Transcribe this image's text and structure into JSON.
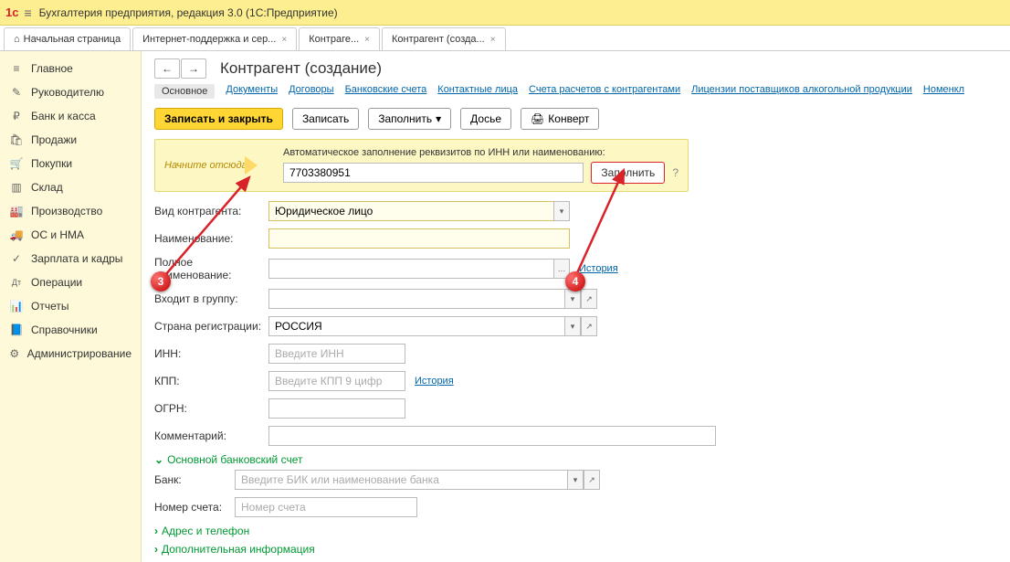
{
  "titlebar": {
    "title": "Бухгалтерия предприятия, редакция 3.0   (1С:Предприятие)"
  },
  "tabs": [
    {
      "label": "Начальная страница",
      "closable": false,
      "home": true
    },
    {
      "label": "Интернет-поддержка и сер...",
      "closable": true
    },
    {
      "label": "Контраге...",
      "closable": true
    },
    {
      "label": "Контрагент (созда...",
      "closable": true,
      "active": true
    }
  ],
  "sidebar": [
    {
      "icon": "≡",
      "label": "Главное"
    },
    {
      "icon": "✎",
      "label": "Руководителю"
    },
    {
      "icon": "₽",
      "label": "Банк и касса"
    },
    {
      "icon": "🛍",
      "label": "Продажи"
    },
    {
      "icon": "🛒",
      "label": "Покупки"
    },
    {
      "icon": "▥",
      "label": "Склад"
    },
    {
      "icon": "🏭",
      "label": "Производство"
    },
    {
      "icon": "🚚",
      "label": "ОС и НМА"
    },
    {
      "icon": "✓",
      "label": "Зарплата и кадры"
    },
    {
      "icon": "Дт",
      "label": "Операции"
    },
    {
      "icon": "📊",
      "label": "Отчеты"
    },
    {
      "icon": "📘",
      "label": "Справочники"
    },
    {
      "icon": "⚙",
      "label": "Администрирование"
    }
  ],
  "page": {
    "heading": "Контрагент (создание)",
    "links": [
      "Основное",
      "Документы",
      "Договоры",
      "Банковские счета",
      "Контактные лица",
      "Счета расчетов с контрагентами",
      "Лицензии поставщиков алкогольной продукции",
      "Номенкл"
    ],
    "active_link": 0,
    "toolbar": {
      "save_close": "Записать и закрыть",
      "save": "Записать",
      "fill": "Заполнить",
      "dossier": "Досье",
      "convert": "Конверт"
    },
    "hint": {
      "start_here": "Начните отсюда",
      "auto_fill_title": "Автоматическое заполнение реквизитов по ИНН или наименованию:",
      "inn_value": "7703380951",
      "fill_btn": "Заполнить"
    },
    "form": {
      "type_label": "Вид контрагента:",
      "type_value": "Юридическое лицо",
      "name_label": "Наименование:",
      "name_value": "",
      "fullname_label": "Полное наименование:",
      "fullname_value": "",
      "history": "История",
      "group_label": "Входит в группу:",
      "group_value": "",
      "country_label": "Страна регистрации:",
      "country_value": "РОССИЯ",
      "inn_label": "ИНН:",
      "inn_placeholder": "Введите ИНН",
      "kpp_label": "КПП:",
      "kpp_placeholder": "Введите КПП 9 цифр",
      "ogrn_label": "ОГРН:",
      "comment_label": "Комментарий:",
      "bank_section": "Основной банковский счет",
      "bank_label": "Банк:",
      "bank_placeholder": "Введите БИК или наименование банка",
      "account_label": "Номер счета:",
      "account_placeholder": "Номер счета",
      "address_section": "Адрес и телефон",
      "extra_section": "Дополнительная информация"
    }
  },
  "markers": {
    "m3": "3",
    "m4": "4"
  }
}
